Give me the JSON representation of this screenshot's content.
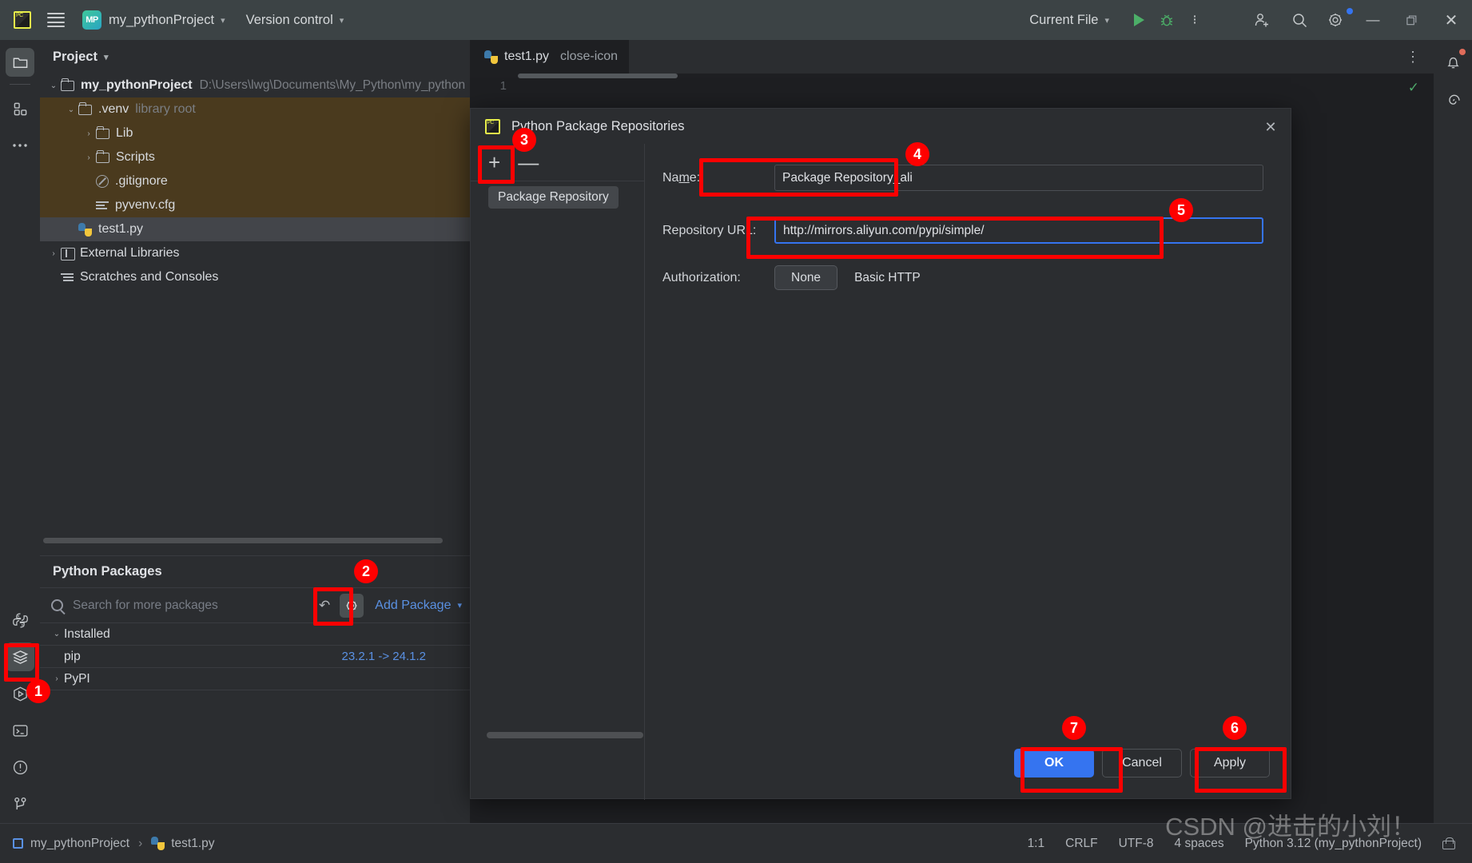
{
  "toolbar": {
    "menu_icon": "hamburger-icon",
    "project_badge": "MP",
    "project_name": "my_pythonProject",
    "version_control": "Version control",
    "run_config": "Current File",
    "run_icon": "run-icon",
    "debug_icon": "debug-icon",
    "more_icon": "more-vertical-icon",
    "share_icon": "add-user-icon",
    "search_icon": "search-icon",
    "settings_icon": "gear-icon",
    "minimize": "—",
    "maximize": "❐",
    "close": "✕"
  },
  "left_rail": {
    "items": [
      {
        "name": "project-tool-window",
        "icon": "folder-icon",
        "active": true
      },
      {
        "name": "commit-tool-window",
        "icon": "blocks-icon",
        "active": false
      },
      {
        "name": "more-tool-windows",
        "icon": "ellipsis-icon",
        "active": false
      }
    ],
    "bottom_items": [
      {
        "name": "python-console",
        "icon": "python-icon",
        "active": false
      },
      {
        "name": "python-packages",
        "icon": "layers-icon",
        "active": true
      },
      {
        "name": "run-tool-window",
        "icon": "play-hex-icon",
        "active": false
      },
      {
        "name": "terminal-tool-window",
        "icon": "terminal-icon",
        "active": false
      },
      {
        "name": "problems-tool-window",
        "icon": "warning-circle-icon",
        "active": false
      },
      {
        "name": "version-control-tool-window",
        "icon": "branch-icon",
        "active": false
      }
    ]
  },
  "right_rail": {
    "items": [
      {
        "name": "notifications",
        "icon": "bell-icon",
        "badge": true
      },
      {
        "name": "ai-assistant",
        "icon": "spiral-icon",
        "badge": false
      }
    ]
  },
  "project_panel": {
    "title": "Project",
    "tree": [
      {
        "label": "my_pythonProject",
        "suffix": "D:\\Users\\lwg\\Documents\\My_Python\\my_python",
        "indent": 0,
        "arrow": "⌄",
        "icon": "folder-icon",
        "bold": true,
        "style": "normal"
      },
      {
        "label": ".venv",
        "suffix": "library root",
        "indent": 1,
        "arrow": "⌄",
        "icon": "folder-icon",
        "bold": false,
        "style": "venv"
      },
      {
        "label": "Lib",
        "suffix": "",
        "indent": 2,
        "arrow": "›",
        "icon": "folder-icon",
        "bold": false,
        "style": "venv"
      },
      {
        "label": "Scripts",
        "suffix": "",
        "indent": 2,
        "arrow": "›",
        "icon": "folder-icon",
        "bold": false,
        "style": "venv"
      },
      {
        "label": ".gitignore",
        "suffix": "",
        "indent": 2,
        "arrow": "",
        "icon": "gitignore-icon",
        "bold": false,
        "style": "venv"
      },
      {
        "label": "pyvenv.cfg",
        "suffix": "",
        "indent": 2,
        "arrow": "",
        "icon": "config-icon",
        "bold": false,
        "style": "venv"
      },
      {
        "label": "test1.py",
        "suffix": "",
        "indent": 1,
        "arrow": "",
        "icon": "python-file-icon",
        "bold": false,
        "style": "selected"
      },
      {
        "label": "External Libraries",
        "suffix": "",
        "indent": 0,
        "arrow": "›",
        "icon": "library-icon",
        "bold": false,
        "style": "normal"
      },
      {
        "label": "Scratches and Consoles",
        "suffix": "",
        "indent": 0,
        "arrow": "",
        "icon": "scratches-icon",
        "bold": false,
        "style": "normal"
      }
    ]
  },
  "packages_panel": {
    "title": "Python Packages",
    "search_placeholder": "Search for more packages",
    "refresh_icon": "refresh-icon",
    "settings_icon": "gear-icon",
    "add_package": "Add Package",
    "rows": [
      {
        "name": "Installed",
        "version": "",
        "arrow": "⌄",
        "group": true
      },
      {
        "name": "pip",
        "version": "23.2.1 -> 24.1.2",
        "arrow": "",
        "group": false
      },
      {
        "name": "PyPI",
        "version": "",
        "arrow": "›",
        "group": true
      }
    ]
  },
  "editor": {
    "tab_label": "test1.py",
    "tab_icon": "python-file-icon",
    "tab_close_icon": "close-icon",
    "more_icon": "more-vertical-icon",
    "line_number": "1",
    "inspection_icon": "checkmark-icon"
  },
  "dialog": {
    "title": "Python Package Repositories",
    "icon": "pycharm-icon",
    "close_icon": "close-icon",
    "add_icon": "+",
    "remove_icon": "—",
    "list_item": "Package Repository",
    "name_label_pre": "Na",
    "name_label_mnemonic": "m",
    "name_label_post": "e:",
    "name_value": "Package Repository_ali",
    "url_label": "Repository URL:",
    "url_value": "http://mirrors.aliyun.com/pypi/simple/",
    "auth_label": "Authorization:",
    "auth_options": [
      "None",
      "Basic HTTP"
    ],
    "auth_selected": "None",
    "ok_label": "OK",
    "cancel_label": "Cancel",
    "apply_label": "Apply"
  },
  "annotations": [
    {
      "number": "1",
      "target": "python-packages-rail-button"
    },
    {
      "number": "2",
      "target": "packages-settings-gear"
    },
    {
      "number": "3",
      "target": "dialog-add-repository"
    },
    {
      "number": "4",
      "target": "repository-name-field"
    },
    {
      "number": "5",
      "target": "repository-url-field"
    },
    {
      "number": "6",
      "target": "apply-button"
    },
    {
      "number": "7",
      "target": "ok-button"
    }
  ],
  "statusbar": {
    "project": "my_pythonProject",
    "separator": "›",
    "file": "test1.py",
    "caret": "1:1",
    "line_sep": "CRLF",
    "encoding": "UTF-8",
    "indent": "4 spaces",
    "interpreter": "Python 3.12 (my_pythonProject)",
    "lock_icon": "lock-icon"
  },
  "watermark": "CSDN @进击的小刘！",
  "colors": {
    "accent_blue": "#3574f0",
    "annotation_red": "#fe0000",
    "venv_highlight": "#4a3a1e",
    "toolbar_bg": "#3c4345",
    "panel_bg": "#2b2d30",
    "editor_bg": "#1e1f22",
    "link_blue": "#5a91e3"
  }
}
